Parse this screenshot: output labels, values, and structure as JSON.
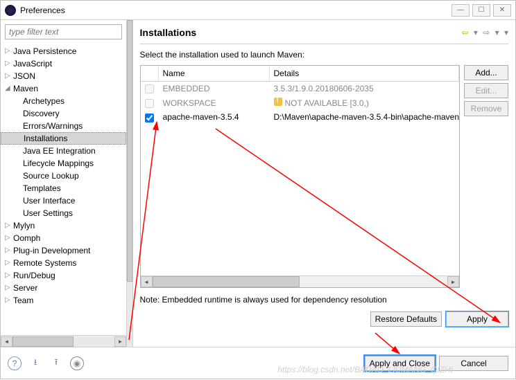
{
  "window": {
    "title": "Preferences"
  },
  "filter": {
    "placeholder": "type filter text"
  },
  "tree": [
    {
      "label": "Java Persistence",
      "expand": "▷"
    },
    {
      "label": "JavaScript",
      "expand": "▷"
    },
    {
      "label": "JSON",
      "expand": "▷"
    },
    {
      "label": "Maven",
      "expand": "◢",
      "children": [
        {
          "label": "Archetypes"
        },
        {
          "label": "Discovery"
        },
        {
          "label": "Errors/Warnings"
        },
        {
          "label": "Installations",
          "selected": true
        },
        {
          "label": "Java EE Integration"
        },
        {
          "label": "Lifecycle Mappings"
        },
        {
          "label": "Source Lookup"
        },
        {
          "label": "Templates"
        },
        {
          "label": "User Interface"
        },
        {
          "label": "User Settings"
        }
      ]
    },
    {
      "label": "Mylyn",
      "expand": "▷"
    },
    {
      "label": "Oomph",
      "expand": "▷"
    },
    {
      "label": "Plug-in Development",
      "expand": "▷"
    },
    {
      "label": "Remote Systems",
      "expand": "▷"
    },
    {
      "label": "Run/Debug",
      "expand": "▷"
    },
    {
      "label": "Server",
      "expand": "▷"
    },
    {
      "label": "Team",
      "expand": "▷"
    }
  ],
  "page": {
    "heading": "Installations",
    "instruction": "Select the installation used to launch Maven:",
    "columns": {
      "name": "Name",
      "details": "Details"
    },
    "rows": [
      {
        "checked": false,
        "disabled": true,
        "name": "EMBEDDED",
        "details": "3.5.3/1.9.0.20180606-2035"
      },
      {
        "checked": false,
        "disabled": true,
        "name": "WORKSPACE",
        "details": "NOT AVAILABLE [3.0,)",
        "warn": true
      },
      {
        "checked": true,
        "disabled": false,
        "name": "apache-maven-3.5.4",
        "details": "D:\\Maven\\apache-maven-3.5.4-bin\\apache-maven"
      }
    ],
    "sideButtons": {
      "add": "Add...",
      "edit": "Edit...",
      "remove": "Remove"
    },
    "note": "Note: Embedded runtime is always used for dependency resolution",
    "restore": "Restore Defaults",
    "apply": "Apply"
  },
  "footer": {
    "applyClose": "Apply and Close",
    "cancel": "Cancel"
  },
  "watermark": "https://blog.csdn.net/BADAO_LIUMANG_QIZHI"
}
